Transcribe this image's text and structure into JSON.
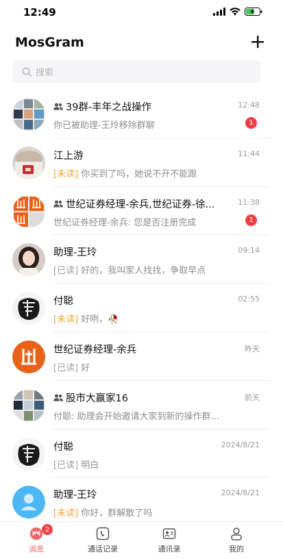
{
  "status_bar": {
    "time": "12:49"
  },
  "header": {
    "title": "MosGram"
  },
  "search": {
    "placeholder": "搜索"
  },
  "chats": [
    {
      "name": "39群-丰年之战操作",
      "is_group": true,
      "time": "12:48",
      "tag": "",
      "tag_type": "",
      "preview": "你已被助理-王玲移除群聊",
      "badge": "1",
      "avatar": "group-collage"
    },
    {
      "name": "江上游",
      "is_group": false,
      "time": "11:44",
      "tag": "[未读]",
      "tag_type": "unread",
      "preview": " 你买到了吗，她说不开不能跟",
      "badge": "",
      "avatar": "photo-person"
    },
    {
      "name": "世纪证券经理-余兵,世纪证券-徐...",
      "is_group": true,
      "time": "11:38",
      "tag": "",
      "tag_type": "",
      "preview": "世纪证券经理-余兵: 您是否注册完成",
      "badge": "1",
      "avatar": "orange-logo-grid"
    },
    {
      "name": "助理-王玲",
      "is_group": false,
      "time": "09:14",
      "tag": "[已读]",
      "tag_type": "read",
      "preview": " 好的，我叫家人找找，争取早点",
      "badge": "",
      "avatar": "photo-woman"
    },
    {
      "name": "付聪",
      "is_group": false,
      "time": "02:55",
      "tag": "[未读]",
      "tag_type": "unread",
      "preview": " 好咧，🥀",
      "badge": "",
      "avatar": "calligraphy"
    },
    {
      "name": "世纪证券经理-余兵",
      "is_group": false,
      "time": "昨天",
      "tag": "[已读]",
      "tag_type": "read",
      "preview": " 好",
      "badge": "",
      "avatar": "orange-logo"
    },
    {
      "name": "股市大赢家16",
      "is_group": true,
      "time": "前天",
      "tag": "",
      "tag_type": "",
      "preview": "付聪: 助理会开始邀请大家到新的操作群...",
      "badge": "",
      "avatar": "group-collage-2"
    },
    {
      "name": "付聪",
      "is_group": false,
      "time": "2024/8/21",
      "tag": "[已读]",
      "tag_type": "read",
      "preview": " 明白",
      "badge": "",
      "avatar": "calligraphy"
    },
    {
      "name": "助理-王玲",
      "is_group": false,
      "time": "2024/8/21",
      "tag": "[未读]",
      "tag_type": "unread",
      "preview": " 你好，群解散了吗",
      "badge": "",
      "avatar": "default-blue"
    }
  ],
  "tabbar": {
    "items": [
      {
        "label": "消息",
        "icon": "message-icon",
        "active": true,
        "badge": "2"
      },
      {
        "label": "通话记录",
        "icon": "phone-icon",
        "active": false,
        "badge": ""
      },
      {
        "label": "通讯录",
        "icon": "contacts-icon",
        "active": false,
        "badge": ""
      },
      {
        "label": "我的",
        "icon": "profile-icon",
        "active": false,
        "badge": ""
      }
    ]
  },
  "colors": {
    "accent_red": "#ee3f45",
    "unread_tag": "#f0a83a",
    "orange_logo": "#e8621a",
    "default_avatar": "#4cb7f5"
  }
}
